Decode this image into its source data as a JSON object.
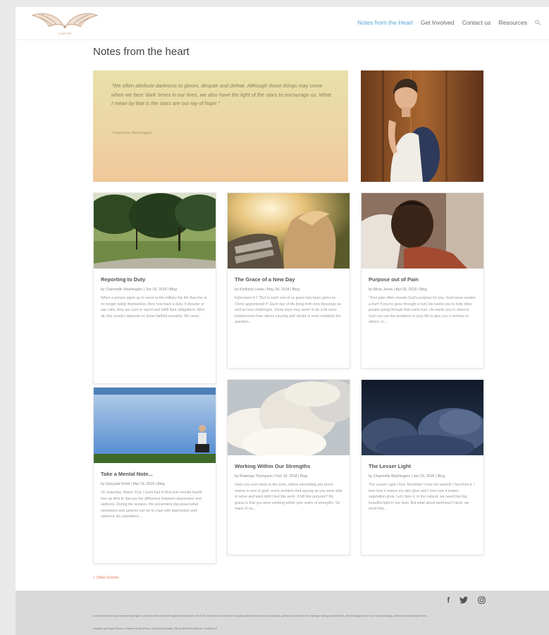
{
  "nav": {
    "items": [
      "Notes from the Heart",
      "Get Involved",
      "Contact us",
      "Resources"
    ],
    "search_icon": "search-icon"
  },
  "page_title": "Notes from the heart",
  "featured_quote": {
    "text": "\"We often attribute darkness to gloom, despair and defeat. Although those things may come when we face 'dark' times in our lives, we also have the light of the stars to encourage us. What I mean by that is the stars are our ray of hope.\"",
    "author": "-Charmelle Washington-"
  },
  "posts": [
    {
      "title": "Reporting to Duty",
      "meta": "by Charmelle Washington | Jun 19, 2018 | Blog",
      "excerpt": "When a person signs up to serve in the military the life they live is no longer solely themselves; they now have a duty. If disaster or war calls, they are sure to report and fulfill their obligations. After all, this country depends on those faithful servants. We need..."
    },
    {
      "title": "The Grace of a New Day",
      "meta": "by Kimberly Lewis | May 28, 2018 | Blog",
      "excerpt": "Ephesians 4:7 \"But to each one of us grace has been given as Christ apportioned it\" Each day of life bring forth new blessings as well as new challenges. Some days may seem to be a bit more burdensome than others causing self- doubt or even establish the question..."
    },
    {
      "title": "Purpose out of Pain",
      "meta": "by Alicia Jones | Apr 03, 2018 | Blog",
      "excerpt": "\"Your pain often reveals God's purpose for you. God never wastes a hurt! If you've gone through a hurt, He wants you to help other people going through that same hurt. He wants you to share it. God can use the problems in your life to give you a ministry to others. In..."
    },
    {
      "title": "Take a Mental Note...",
      "meta": "by Gracyale Knott | Mar 19, 2018 | Blog",
      "excerpt": "On Saturday, March 31st, I knelt had to find ever mental health free up time to discuss the difference between depression and sadness. During the session, the presenters discussed what caretakers and parents can do to cope with depression and sadness. As caretakers,..."
    },
    {
      "title": "Working Within Our Strengths",
      "meta": "by Roderiqa Thompson | Feb 18, 2018 | Blog",
      "excerpt": "Have you ever been in the zone, where everything you touch seems to turn to gold; every problem that sprang up you were able to solve and work didn't feel like work. It felt like purpose? My guess is that you were working within your realm of strengths. So many of us..."
    },
    {
      "title": "The Lesser Light",
      "meta": "by Charmelle Washington | Jan 15, 2018 | Blog",
      "excerpt": "The Lesser Light I love Sunshine! I love the warmth I feel from it. I love how it makes my skin glow and I love how it makes vegetation grow. Let's face it, in the natural, we need that big, beautiful light in our lives. But what about darkness? Heck, we need that..."
    }
  ],
  "older_entries": "« Older Entries",
  "footer": {
    "social": [
      {
        "icon": "facebook-icon",
        "glyph": "f"
      },
      {
        "icon": "twitter-icon",
        "glyph": "🐦"
      },
      {
        "icon": "instagram-icon",
        "glyph": "◎"
      }
    ],
    "text": "Comfort Givers serving Charmelle Washington is a 501c3 when receive the organization's stated in rate 2016. Our Mission is to minister in hospital patients and survivors to education, spread and order from the challenges coming up that families. We will always be true to our strong shooting, comfort and care giving the here.",
    "credits": "Designed by Elegant Themes | Powered by WordPress | Hosted by GoDaddy | Site by Website Excellence | Sunflower-D"
  },
  "colors": {
    "active_nav": "#5ba4d6",
    "older_link": "#e07a5a",
    "quote_bg_top": "#e9e0a9",
    "quote_bg_bottom": "#f0c79a",
    "footer_bg": "#d9d9d9"
  }
}
